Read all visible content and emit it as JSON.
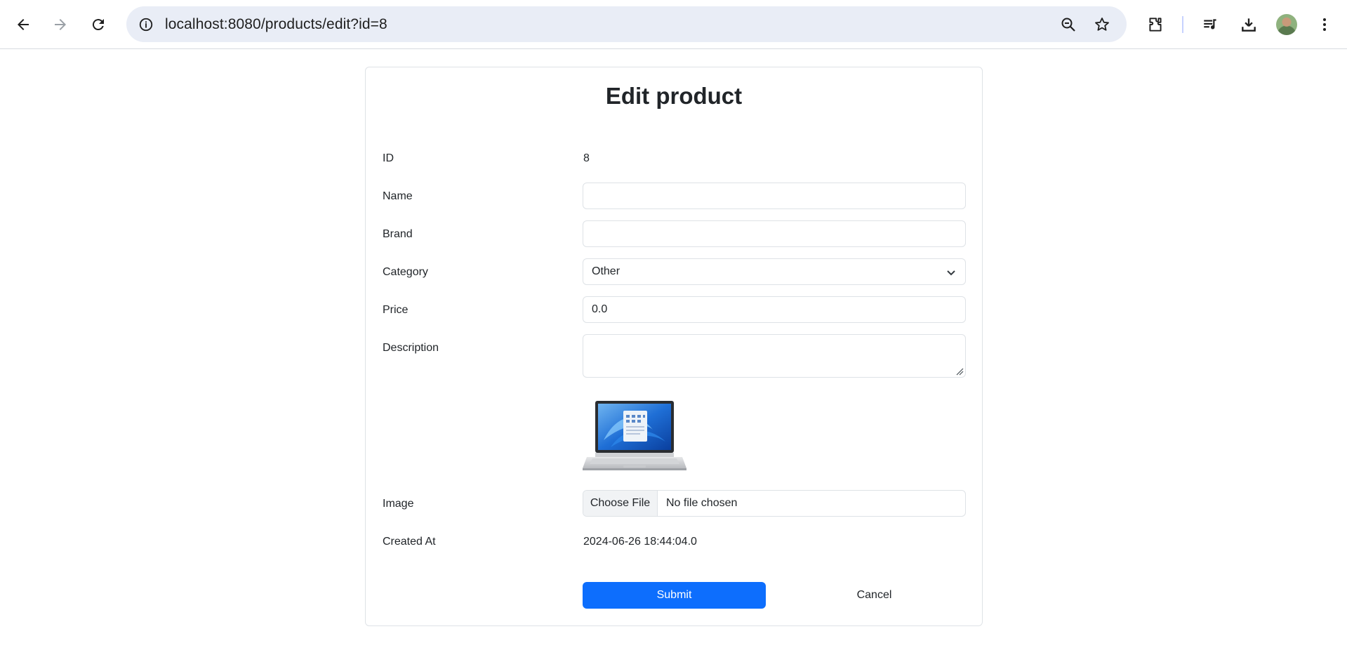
{
  "browser": {
    "url": "localhost:8080/products/edit?id=8",
    "icons": [
      "back-icon",
      "forward-icon",
      "reload-icon",
      "site-info-icon",
      "zoom-out-icon",
      "bookmark-star-icon",
      "extensions-icon",
      "media-controls-icon",
      "downloads-icon",
      "profile-avatar",
      "menu-icon"
    ]
  },
  "page": {
    "title": "Edit product"
  },
  "form": {
    "id": {
      "label": "ID",
      "value": "8"
    },
    "name": {
      "label": "Name",
      "value": ""
    },
    "brand": {
      "label": "Brand",
      "value": ""
    },
    "category": {
      "label": "Category",
      "selected": "Other"
    },
    "price": {
      "label": "Price",
      "value": "0.0"
    },
    "description": {
      "label": "Description",
      "value": ""
    },
    "image": {
      "label": "Image",
      "choose_label": "Choose File",
      "status": "No file chosen"
    },
    "created_at": {
      "label": "Created At",
      "value": "2024-06-26 18:44:04.0"
    },
    "submit_label": "Submit",
    "cancel_label": "Cancel"
  },
  "colors": {
    "primary": "#0d6efd",
    "border": "#dee2e6",
    "omnibox": "#e9edf6"
  }
}
